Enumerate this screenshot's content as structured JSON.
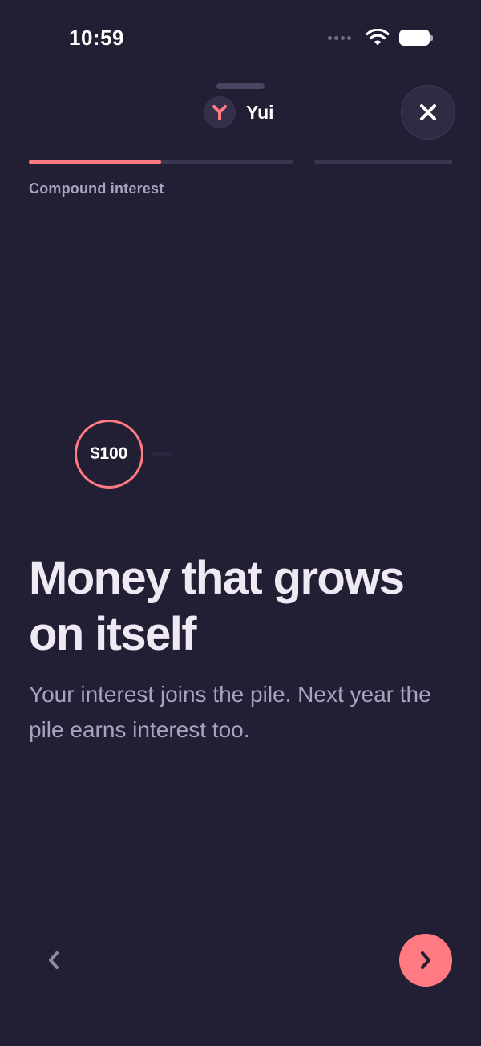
{
  "status_bar": {
    "time": "10:59",
    "icons": [
      "signal-dots-icon",
      "wifi-icon",
      "battery-icon"
    ]
  },
  "header": {
    "brand_name": "Yui",
    "brand_icon": "yui-logo-icon",
    "close_icon": "close-icon"
  },
  "progress": {
    "segments": [
      {
        "fill_fraction": 0.5
      },
      {
        "fill_fraction": 0.0
      }
    ],
    "section_label": "Compound interest"
  },
  "illustration": {
    "coin_label": "$100"
  },
  "content": {
    "headline": "Money that grows on itself",
    "body": "Your interest joins the pile. Next year the pile earns interest too."
  },
  "navigation": {
    "prev_icon": "chevron-left-icon",
    "next_icon": "chevron-right-icon"
  },
  "colors": {
    "background": "#221e34",
    "accent": "#ff7a82",
    "track": "#3b3650",
    "muted_text": "#a8a1bf",
    "primary_text": "#efe9f4"
  }
}
